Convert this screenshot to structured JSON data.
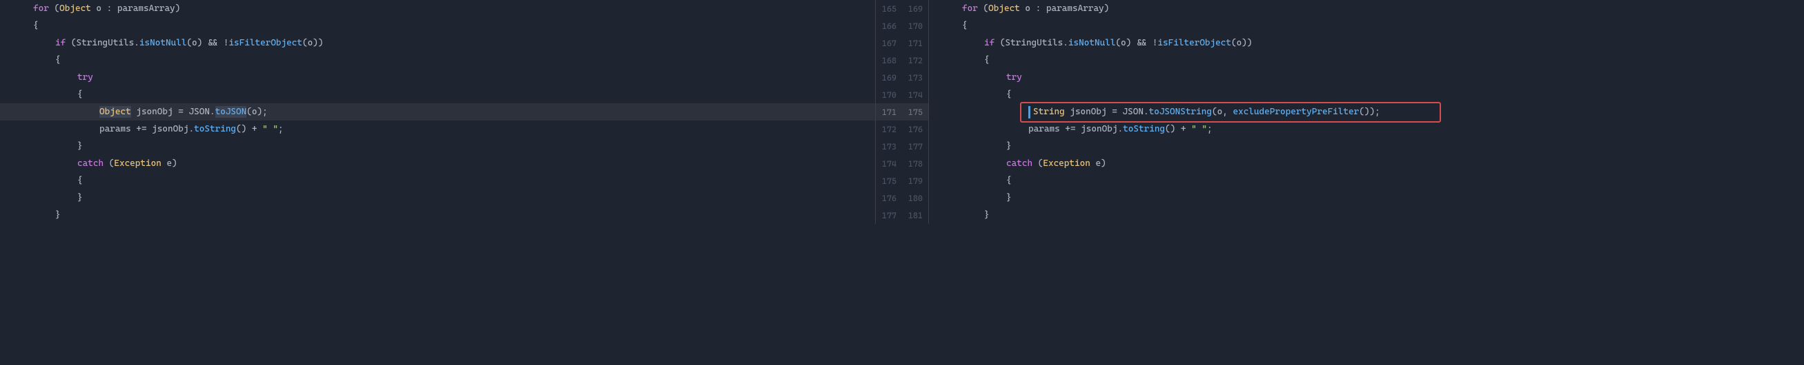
{
  "gutter": {
    "left": [
      "165",
      "166",
      "167",
      "168",
      "169",
      "170",
      "171",
      "172",
      "173",
      "174",
      "175",
      "176",
      "177"
    ],
    "right": [
      "169",
      "170",
      "171",
      "172",
      "173",
      "174",
      "175",
      "176",
      "177",
      "178",
      "179",
      "180",
      "181"
    ]
  },
  "left": {
    "l0_for": "for",
    "l0_type": "Object",
    "l0_rest": " o : paramsArray)",
    "l1": "{",
    "l2_if": "if",
    "l2_a": " (StringUtils.",
    "l2_m1": "isNotNull",
    "l2_b": "(o) && !",
    "l2_m2": "isFilterObject",
    "l2_c": "(o))",
    "l3": "{",
    "l4": "try",
    "l5": "{",
    "l6_type": "Object",
    "l6_a": " jsonObj = JSON.",
    "l6_m": "toJSON",
    "l6_b": "(o);",
    "l7_a": "params += jsonObj.",
    "l7_m": "toString",
    "l7_b": "() + ",
    "l7_s": "\" \"",
    "l7_c": ";",
    "l8": "}",
    "l9_catch": "catch",
    "l9_a": " (",
    "l9_type": "Exception",
    "l9_b": " e)",
    "l10": "{",
    "l11": "}",
    "l12": "}"
  },
  "right": {
    "l0_for": "for",
    "l0_type": "Object",
    "l0_rest": " o : paramsArray)",
    "l1": "{",
    "l2_if": "if",
    "l2_a": " (StringUtils.",
    "l2_m1": "isNotNull",
    "l2_b": "(o) && !",
    "l2_m2": "isFilterObject",
    "l2_c": "(o))",
    "l3": "{",
    "l4": "try",
    "l5": "{",
    "l6_type": "String",
    "l6_a": " jsonObj = JSON.",
    "l6_m": "toJSONString",
    "l6_b": "(o, ",
    "l6_m2": "excludePropertyPreFilter",
    "l6_c": "());",
    "l7_a": "params += jsonObj.",
    "l7_m": "toString",
    "l7_b": "() + ",
    "l7_s": "\" \"",
    "l7_c": ";",
    "l8": "}",
    "l9_catch": "catch",
    "l9_a": " (",
    "l9_type": "Exception",
    "l9_b": " e)",
    "l10": "{",
    "l11": "}",
    "l12": "}"
  }
}
